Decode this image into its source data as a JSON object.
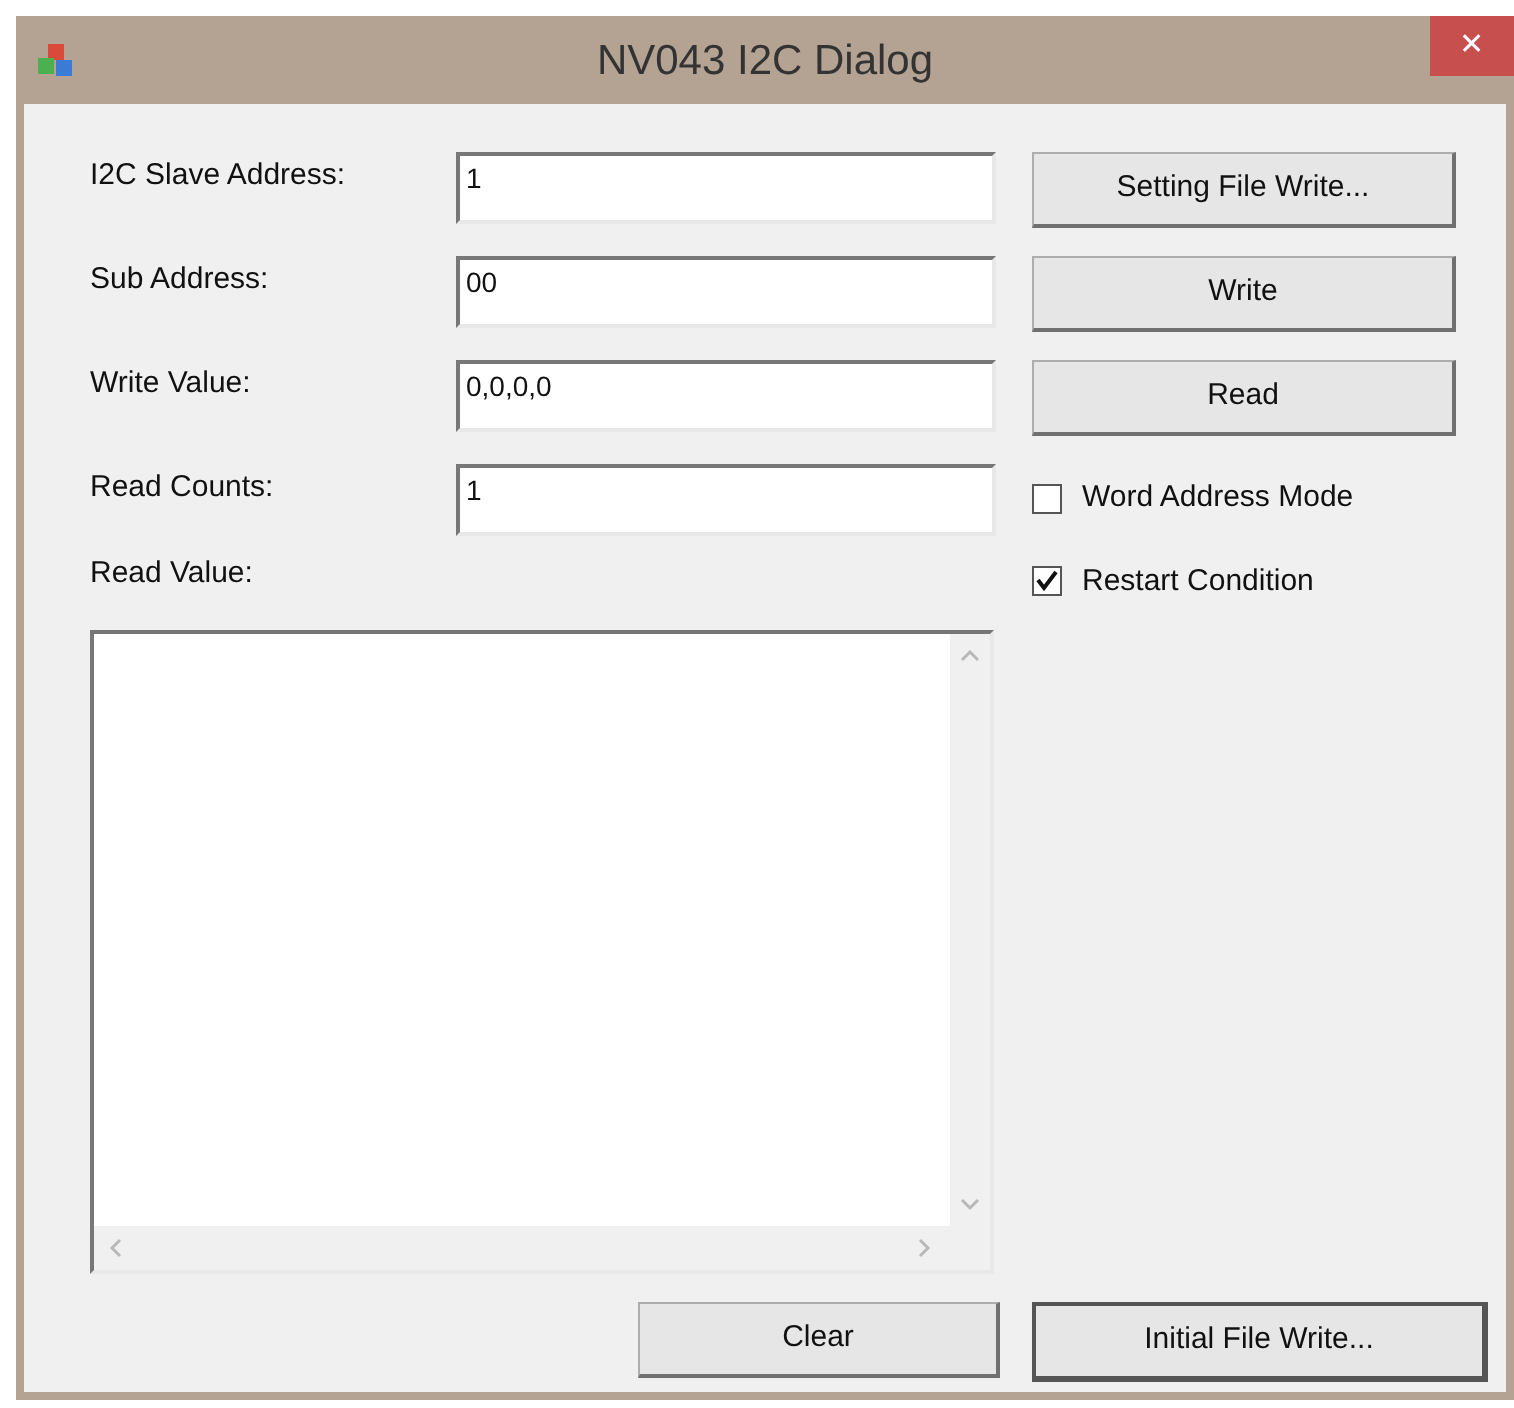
{
  "window": {
    "title": "NV043 I2C Dialog",
    "close": "✕"
  },
  "fields": [
    {
      "label": "I2C Slave Address:",
      "value": "1"
    },
    {
      "label": "Sub Address:",
      "value": "00"
    },
    {
      "label": "Write Value:",
      "value": "0,0,0,0"
    },
    {
      "label": "Read Counts:",
      "value": "1"
    }
  ],
  "read_value": {
    "label": "Read Value:"
  },
  "buttons": [
    "Setting File Write...",
    "Write",
    "Read"
  ],
  "checkboxes": [
    {
      "label": "Word Address Mode",
      "checked": false
    },
    {
      "label": "Restart Condition",
      "checked": true
    }
  ],
  "bottom_buttons": [
    {
      "label": "Clear",
      "focused": false
    },
    {
      "label": "Initial File Write...",
      "focused": true
    }
  ]
}
